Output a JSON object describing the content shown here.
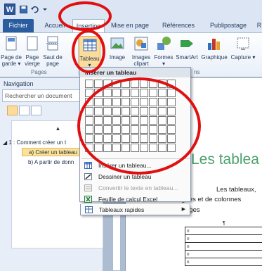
{
  "app": {
    "logo_letter": "W"
  },
  "tabs": [
    {
      "label": "Fichier"
    },
    {
      "label": "Accueil"
    },
    {
      "label": "Insertion"
    },
    {
      "label": "Mise en page"
    },
    {
      "label": "Références"
    },
    {
      "label": "Publipostage"
    },
    {
      "label": "R"
    }
  ],
  "ribbon": {
    "buttons": [
      {
        "label": "Page de garde ▾"
      },
      {
        "label": "Page vierge"
      },
      {
        "label": "Saut de page"
      },
      {
        "label": "Tableau ▾"
      },
      {
        "label": "Image"
      },
      {
        "label": "Images clipart"
      },
      {
        "label": "Formes ▾"
      },
      {
        "label": "SmartArt"
      },
      {
        "label": "Graphique"
      },
      {
        "label": "Capture ▾"
      }
    ],
    "groups": {
      "pages": "Pages",
      "ns": "ns"
    }
  },
  "navigation": {
    "title": "Navigation",
    "search_placeholder": "Rechercher un document",
    "up_arrow": "▲",
    "items": [
      {
        "label": "◢ 1 : Comment créer un t"
      },
      {
        "label": "a) Créer un tableau"
      },
      {
        "label": "b) A partir de donn"
      }
    ]
  },
  "dropdown": {
    "header": "Insérer un tableau",
    "grid_cols": 10,
    "grid_rows": 8,
    "items": [
      {
        "label": "Insérer un tableau...",
        "disabled": false
      },
      {
        "label": "Dessiner un tableau",
        "disabled": false
      },
      {
        "label": "Convertir le texte en tableau...",
        "disabled": true
      },
      {
        "label": "Feuille de calcul Excel",
        "disabled": false
      },
      {
        "label": "Tableaux rapides",
        "disabled": false,
        "submenu": true
      }
    ]
  },
  "document": {
    "title": "Les tablea",
    "line1": "Les tableaux,",
    "line2": "lignes et de colonnes",
    "line3": "images",
    "table_marker": "¤",
    "table_header_mark": "¶"
  },
  "colors": {
    "annotation_red": "#e01010",
    "file_tab": "#2a5d9f",
    "title_green": "#4ba06c"
  }
}
